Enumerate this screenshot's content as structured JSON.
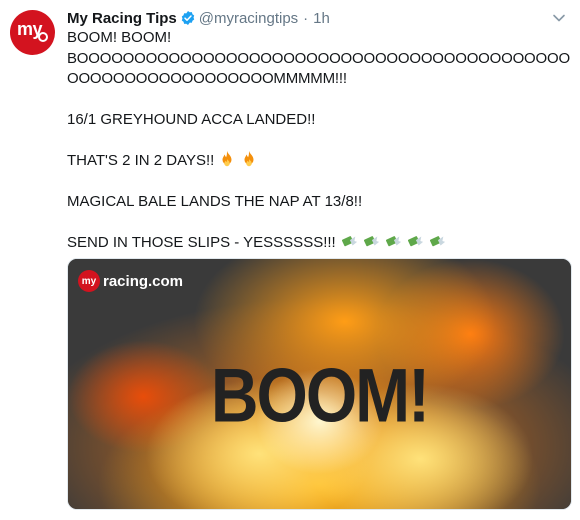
{
  "account": {
    "name": "My Racing Tips",
    "handle": "@myracingtips",
    "separator": "·",
    "time": "1h",
    "avatar_text": "my"
  },
  "tweet": {
    "line1": "BOOM! BOOM!",
    "line2": "BOOOOOOOOOOOOOOOOOOOOOOOOOOOOOOOOOOOOOOOOOOOOOOOOOOOOOOOOOOOOOMMMMM!!!",
    "line3": "16/1 GREYHOUND ACCA LANDED!!",
    "line4": "THAT'S 2 IN 2 DAYS!!",
    "line5": "MAGICAL BALE LANDS THE NAP AT 13/8!!",
    "line6": "SEND IN THOSE SLIPS - YESSSSSS!!!"
  },
  "media": {
    "logo_badge": "my",
    "logo_brand": "racing.com",
    "headline": "BOOM!"
  },
  "icons": {
    "verified": "verified-badge-icon",
    "caret": "chevron-down-icon",
    "fire": "fire-emoji-icon",
    "money": "money-with-wings-emoji-icon"
  },
  "colors": {
    "brand_red": "#d3131f",
    "verified_blue": "#1da1f2",
    "secondary_text": "#657786"
  }
}
